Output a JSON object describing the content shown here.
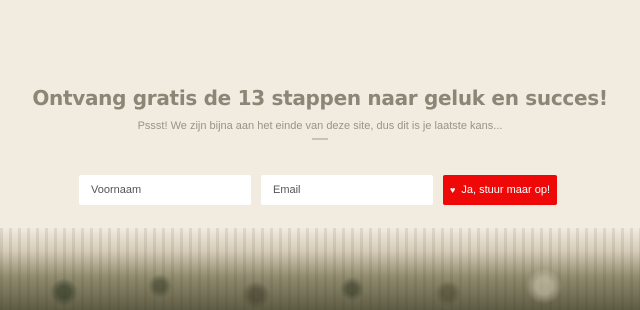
{
  "signup": {
    "headline": "Ontvang gratis de 13 stappen naar geluk en succes!",
    "subtitle": "Pssst! We zijn bijna aan het einde van deze site, dus dit is je laatste kans...",
    "first_name_placeholder": "Voornaam",
    "email_placeholder": "Email",
    "submit_label": "Ja, stuur maar op!",
    "submit_icon": "heart-icon"
  },
  "colors": {
    "background": "#f1ebe0",
    "headline": "#8b8675",
    "button": "#ee0808"
  }
}
